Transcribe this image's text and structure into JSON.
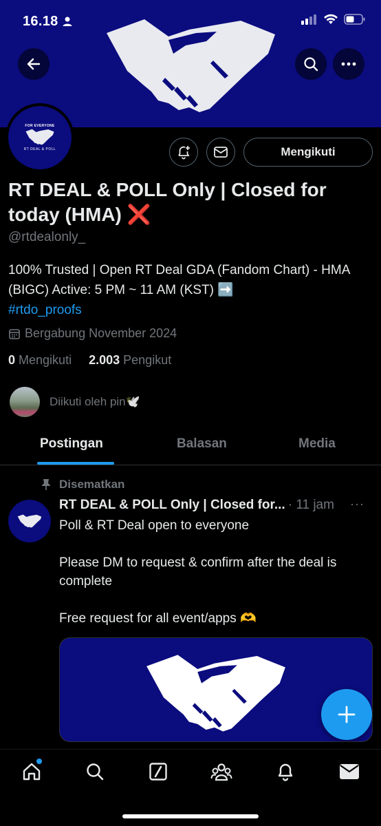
{
  "status_bar": {
    "time": "16.18"
  },
  "profile": {
    "display_name": "RT DEAL & POLL Only | Closed for today (HMA) ❌",
    "handle": "@rtdealonly_",
    "bio_text": "100% Trusted | Open RT Deal GDA (Fandom Chart) - HMA (BIGC) Active: 5 PM ~ 11 AM (KST) ➡️",
    "bio_hashtag": "#rtdo_proofs",
    "joined": "Bergabung November 2024",
    "following_count": "0",
    "following_label": "Mengikuti",
    "followers_count": "2.003",
    "followers_label": "Pengikut",
    "followed_by": "Diikuti oleh pin🕊️",
    "follow_button": "Mengikuti",
    "avatar_top_text": "FOR EVERYONE",
    "avatar_bottom_text": "RT DEAL & POLL"
  },
  "tabs": [
    {
      "label": "Postingan",
      "active": true
    },
    {
      "label": "Balasan",
      "active": false
    },
    {
      "label": "Media",
      "active": false
    }
  ],
  "post": {
    "pinned_label": "Disematkan",
    "author": "RT DEAL & POLL Only | Closed for...",
    "time": "· 11 jam",
    "more": "···",
    "text": "Poll & RT Deal open to everyone\n\nPlease DM to request & confirm after the deal is complete\n\nFree request for all event/apps 🫶"
  },
  "colors": {
    "accent": "#1d9bf0",
    "banner": "#0b0c7e",
    "background": "#000000",
    "muted_text": "#71767b"
  },
  "bottom_nav": [
    "home-icon",
    "search-icon",
    "grok-icon",
    "communities-icon",
    "notifications-icon",
    "messages-icon"
  ]
}
